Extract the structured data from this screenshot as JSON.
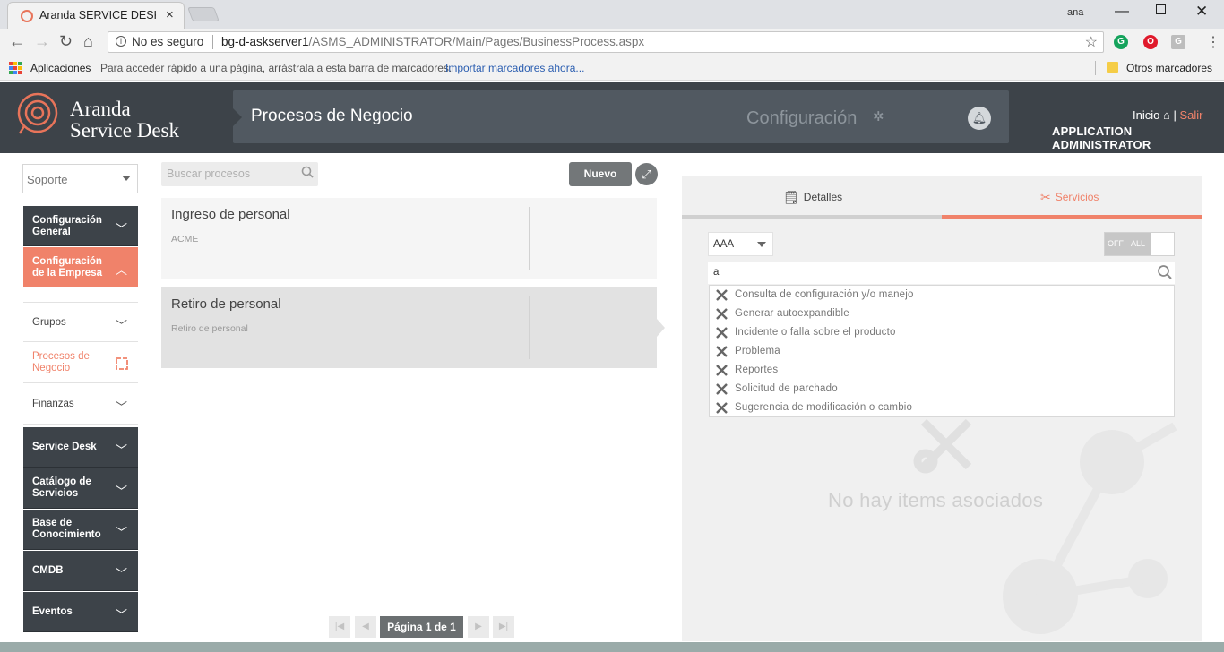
{
  "browser": {
    "tab_title": "Aranda SERVICE DESK CC",
    "close_glyph": "×",
    "win_user": "ana",
    "secure_label": "No es seguro",
    "url_host": "bg-d-askserver1",
    "url_path": "/ASMS_ADMINISTRATOR/Main/Pages/BusinessProcess.aspx"
  },
  "bookmarks": {
    "apps": "Aplicaciones",
    "hint": "Para acceder rápido a una página, arrástrala a esta barra de marcadores.",
    "import": "Importar marcadores ahora...",
    "other": "Otros marcadores"
  },
  "header": {
    "logo_line1": "Aranda",
    "logo_line2": "Service Desk",
    "page_title": "Procesos de Negocio",
    "config_label": "Configuración",
    "inicio": "Inicio",
    "separator": "|",
    "salir": "Salir",
    "user": "APPLICATION ADMINISTRATOR"
  },
  "sidebar": {
    "module_select": "Soporte",
    "items": [
      {
        "label": "Configuración General"
      },
      {
        "label": "Configuración de la Empresa"
      },
      {
        "label": "Grupos"
      },
      {
        "label": "Procesos de Negocio"
      },
      {
        "label": "Finanzas"
      },
      {
        "label": "Service Desk"
      },
      {
        "label": "Catálogo de Servicios"
      },
      {
        "label": "Base de Conocimiento"
      },
      {
        "label": "CMDB"
      },
      {
        "label": "Eventos"
      }
    ]
  },
  "processes": {
    "search_placeholder": "Buscar procesos",
    "new_label": "Nuevo",
    "items": [
      {
        "name": "Ingreso de personal",
        "sub": "ACME"
      },
      {
        "name": "Retiro de personal",
        "sub": "Retiro de personal"
      }
    ],
    "pager_label": "Página 1 de 1"
  },
  "detail": {
    "tab_detalles": "Detalles",
    "tab_servicios": "Servicios",
    "filter_value": "AAA",
    "toggle_off": "OFF",
    "toggle_all": "ALL",
    "search_value": "a",
    "services": [
      "Consulta de configuración y/o manejo",
      "Generar autoexpandible",
      "Incidente o falla sobre el producto",
      "Problema",
      "Reportes",
      "Solicitud de parchado",
      "Sugerencia de modificación o cambio"
    ],
    "empty_message": "No hay items asociados"
  },
  "colors": {
    "accent": "#f0826a",
    "dark": "#3d4349",
    "panel": "#515961"
  }
}
